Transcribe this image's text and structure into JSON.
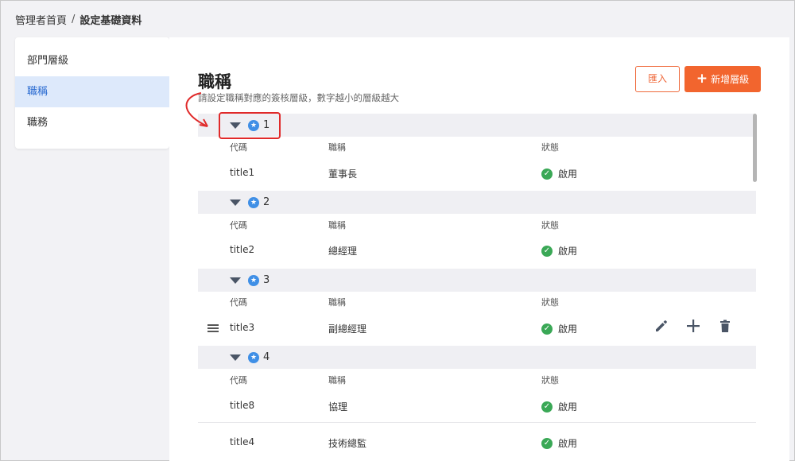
{
  "breadcrumb": {
    "home": "管理者首頁",
    "separator": "/",
    "current": "設定基礎資料"
  },
  "sidebar": {
    "items": [
      {
        "label": "部門層級",
        "active": false
      },
      {
        "label": "職稱",
        "active": true
      },
      {
        "label": "職務",
        "active": false
      }
    ]
  },
  "page": {
    "title": "職稱",
    "subtitle": "請設定職稱對應的簽核層級，數字越小的層級越大",
    "import_label": "匯入",
    "add_label": "新增層級"
  },
  "columns": {
    "code": "代碼",
    "name": "職稱",
    "status": "狀態"
  },
  "groups": [
    {
      "level": "1",
      "rows": [
        {
          "code": "title1",
          "name": "董事長",
          "status": "啟用"
        }
      ]
    },
    {
      "level": "2",
      "rows": [
        {
          "code": "title2",
          "name": "總經理",
          "status": "啟用"
        }
      ]
    },
    {
      "level": "3",
      "rows": [
        {
          "code": "title3",
          "name": "副總經理",
          "status": "啟用"
        }
      ]
    },
    {
      "level": "4",
      "rows": [
        {
          "code": "title8",
          "name": "協理",
          "status": "啟用"
        },
        {
          "code": "title4",
          "name": "技術總監",
          "status": "啟用"
        }
      ]
    }
  ],
  "colors": {
    "accent": "#f2652e",
    "active_bg": "#dde9fb",
    "active_text": "#2a6bd1",
    "status_ok": "#3aa856",
    "callout": "#e02a2a"
  },
  "icons": {
    "expand": "caret-down-icon",
    "level": "star-badge-icon",
    "status": "check-circle-icon",
    "edit": "pencil-icon",
    "add": "plus-icon",
    "delete": "trash-icon",
    "drag": "drag-handle-icon"
  }
}
